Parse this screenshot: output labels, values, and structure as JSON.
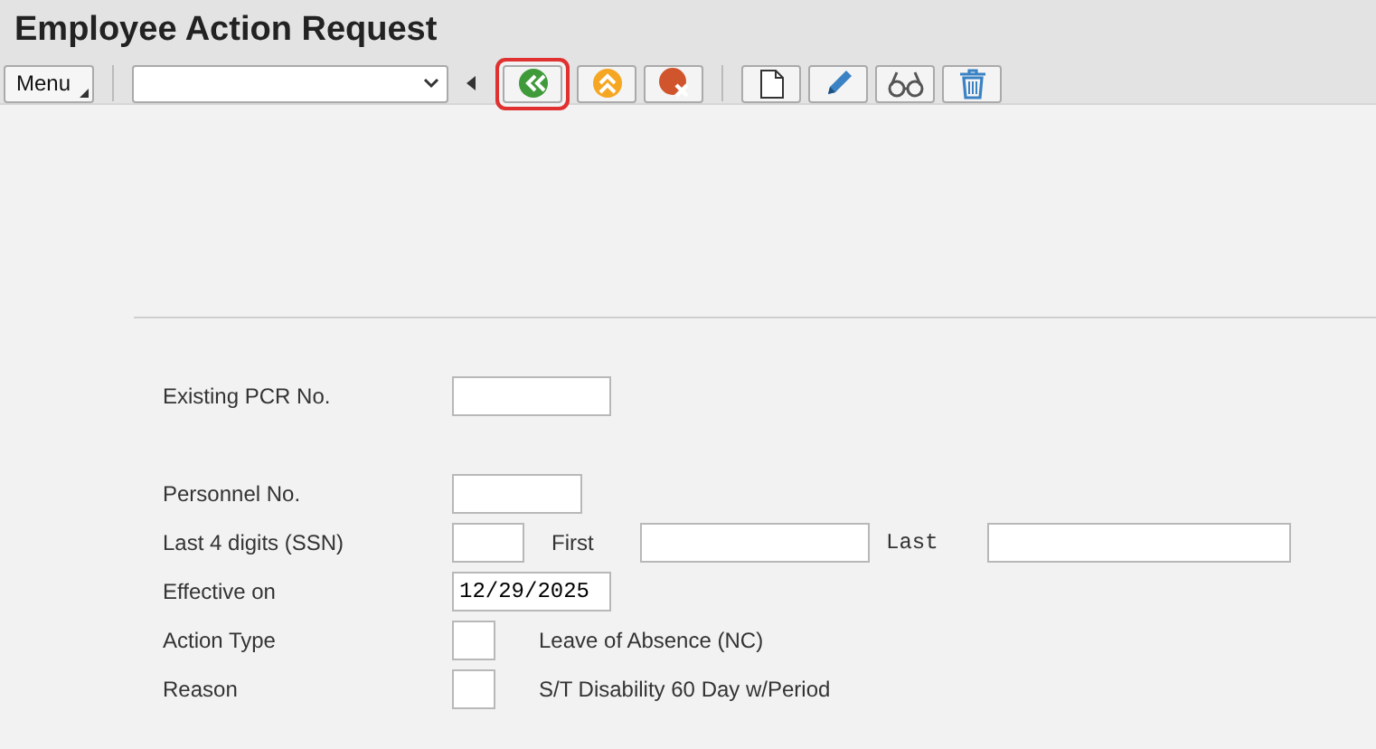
{
  "window": {
    "title": "Employee Action Request"
  },
  "toolbar": {
    "menu": "Menu",
    "groups": [
      [
        {
          "kind": "back",
          "highlighted": true
        },
        {
          "kind": "up",
          "highlighted": false
        },
        {
          "kind": "cancel",
          "highlighted": false
        }
      ],
      [
        {
          "kind": "new",
          "highlighted": false
        },
        {
          "kind": "edit",
          "highlighted": false
        },
        {
          "kind": "display",
          "highlighted": false
        },
        {
          "kind": "delete",
          "highlighted": false
        }
      ]
    ]
  },
  "form": {
    "sections": [
      [
        {
          "label": "Existing PCR No.",
          "fields": [
            {
              "kind": "input"
            }
          ]
        }
      ],
      [
        {
          "label": "Personnel No.",
          "fields": [
            {
              "kind": "input"
            }
          ]
        },
        {
          "label": "Last 4 digits (SSN)",
          "fields": [
            {
              "kind": "input"
            },
            {
              "kind": "text",
              "text": "First"
            },
            {
              "kind": "input"
            },
            {
              "kind": "mono-text",
              "text": "Last"
            },
            {
              "kind": "input"
            }
          ]
        },
        {
          "label": "Effective on",
          "fields": [
            {
              "kind": "input",
              "value": "12/29/2025"
            }
          ]
        },
        {
          "label": "Action Type",
          "fields": [
            {
              "kind": "input"
            },
            {
              "kind": "text",
              "text": "Leave of Absence (NC)"
            }
          ]
        },
        {
          "label": "Reason",
          "fields": [
            {
              "kind": "input"
            },
            {
              "kind": "text",
              "text": "S/T Disability 60 Day w/Period"
            }
          ]
        }
      ]
    ]
  }
}
